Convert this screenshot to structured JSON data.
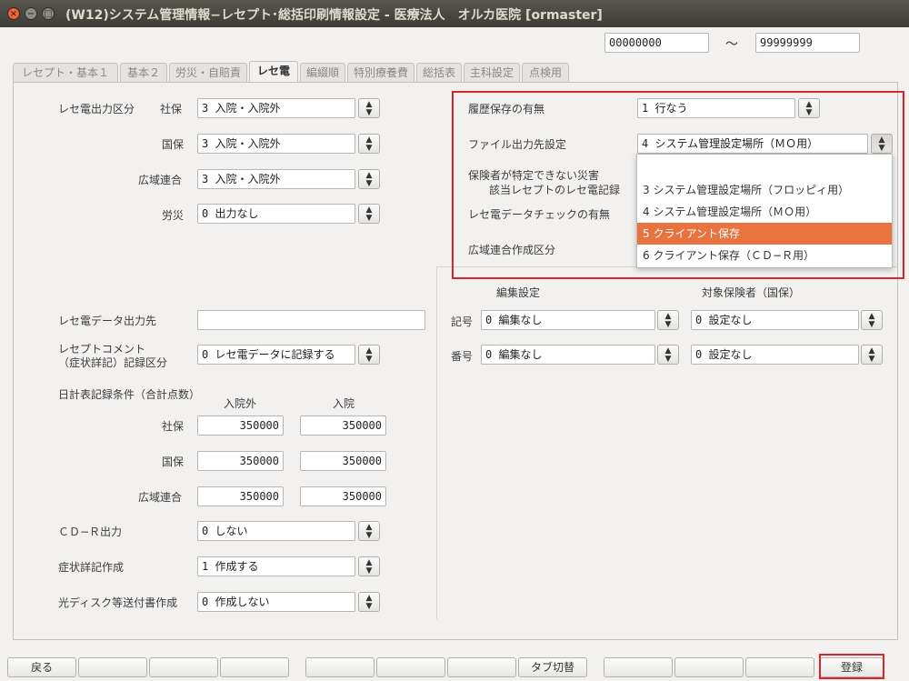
{
  "window": {
    "title": "(W12)システム管理情報−レセプト･総括印刷情報設定 - 医療法人　オルカ医院  [ormaster]",
    "close_glyph": "×",
    "min_glyph": "−",
    "max_glyph": "□"
  },
  "header": {
    "range_from": "00000000",
    "range_sep": "〜",
    "range_to": "99999999"
  },
  "tabs": [
    {
      "label": "レセプト・基本１"
    },
    {
      "label": "基本２"
    },
    {
      "label": "労災・自賠責"
    },
    {
      "label": "レセ電",
      "active": true
    },
    {
      "label": "編綴順"
    },
    {
      "label": "特別療養費"
    },
    {
      "label": "総括表"
    },
    {
      "label": "主科設定"
    },
    {
      "label": "点検用"
    }
  ],
  "left": {
    "rece_output_label": "レセ電出力区分",
    "shaho_label": "社保",
    "shaho_value": "3 入院・入院外",
    "kokuho_label": "国保",
    "kokuho_value": "3 入院・入院外",
    "koiki_label": "広域連合",
    "koiki_value": "3 入院・入院外",
    "rosai_label": "労災",
    "rosai_value": "0 出力なし",
    "data_dest_label": "レセ電データ出力先",
    "data_dest_value": "",
    "comment_label_1": "レセプトコメント",
    "comment_label_2": "（症状詳記）記録区分",
    "comment_value": "0 レセ電データに記録する",
    "daily_label": "日計表記録条件（合計点数）",
    "col_outpatient": "入院外",
    "col_inpatient": "入院",
    "daily_shaho_label": "社保",
    "daily_shaho_out": "350000",
    "daily_shaho_in": "350000",
    "daily_kokuho_label": "国保",
    "daily_kokuho_out": "350000",
    "daily_kokuho_in": "350000",
    "daily_koiki_label": "広域連合",
    "daily_koiki_out": "350000",
    "daily_koiki_in": "350000",
    "cdr_label": "ＣＤ−Ｒ出力",
    "cdr_value": "0 しない",
    "symptom_label": "症状詳記作成",
    "symptom_value": "1 作成する",
    "disk_label": "光ディスク等送付書作成",
    "disk_value": "0 作成しない"
  },
  "right": {
    "history_label": "履歴保存の有無",
    "history_value": "1 行なう",
    "file_dest_label": "ファイル出力先設定",
    "file_dest_value": "4 システム管理設定場所（ＭＯ用）",
    "disaster_label_1": "保険者が特定できない災害",
    "disaster_label_2": "該当レセプトのレセ電記録",
    "datacheck_label": "レセ電データチェックの有無",
    "koiki_create_label": "広域連合作成区分",
    "edit_setting_label": "編集設定",
    "target_insurer_label": "対象保険者（国保）",
    "kigo_label": "記号",
    "kigo_edit": "0 編集なし",
    "kigo_target": "0 設定なし",
    "bango_label": "番号",
    "bango_edit": "0 編集なし",
    "bango_target": "0 設定なし"
  },
  "popup": {
    "items": [
      {
        "label": "3 システム管理設定場所（フロッピィ用）"
      },
      {
        "label": "4 システム管理設定場所（ＭＯ用）"
      },
      {
        "label": "5 クライアント保存",
        "selected": true
      },
      {
        "label": "6 クライアント保存（ＣＤ−Ｒ用）"
      }
    ]
  },
  "footer": {
    "back_label": "戻る",
    "tab_switch_label": "タブ切替",
    "register_label": "登録"
  },
  "colors": {
    "accent": "#e9733f",
    "highlight_box": "#d9262a"
  }
}
